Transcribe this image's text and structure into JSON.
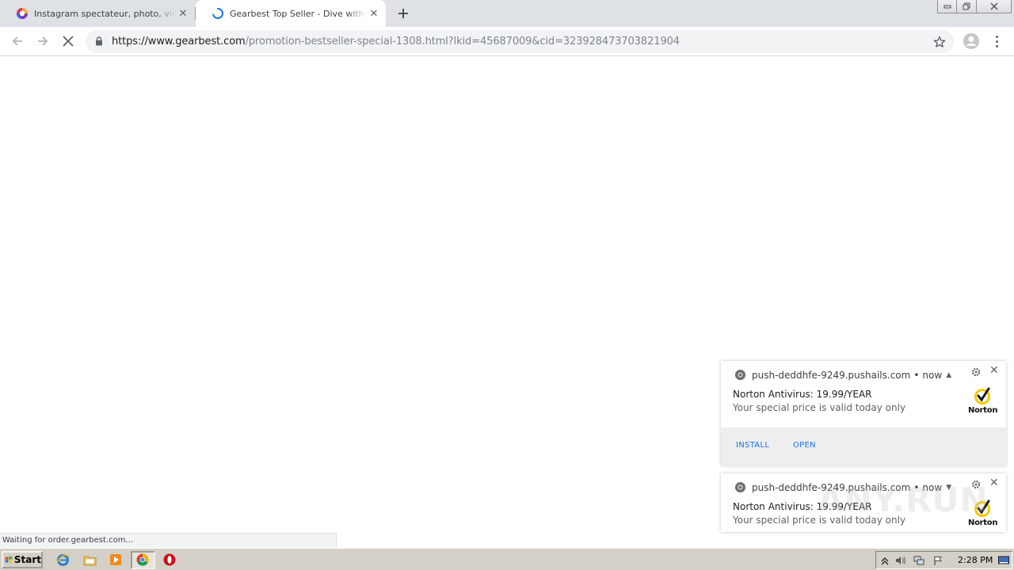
{
  "tabs": [
    {
      "title": "Instagram spectateur, photo, vidéo",
      "active": false
    },
    {
      "title": "Gearbest Top Seller - Dive with the Gearbest",
      "active": true,
      "loading": true
    }
  ],
  "address": {
    "host": "https://www.gearbest.com",
    "path": "/promotion-bestseller-special-1308.html?lkid=45687009&cid=323928473703821904"
  },
  "status_bubble": "Waiting for order.gearbest.com...",
  "notifications": [
    {
      "origin": "push-deddhfe-9249.pushails.com",
      "time": "now",
      "expanded": true,
      "title": "Norton Antivirus: 19.99/YEAR",
      "body": "Your special price is valid today only",
      "logo_text": "Norton",
      "actions": [
        "INSTALL",
        "OPEN"
      ]
    },
    {
      "origin": "push-deddhfe-9249.pushails.com",
      "time": "now",
      "expanded": false,
      "title": "Norton Antivirus: 19.99/YEAR",
      "body": "Your special price is valid today only",
      "logo_text": "Norton"
    }
  ],
  "watermark": "ANY.RUN",
  "taskbar": {
    "start_label": "Start",
    "clock": "2:28 PM",
    "pinned": [
      "ie-icon",
      "explorer-icon",
      "media-player-icon",
      "chrome-icon",
      "opera-icon"
    ]
  },
  "colors": {
    "tabstrip": "#dee1e6",
    "accent": "#1a73e8",
    "taskbar": "#d4d0c8",
    "norton_yellow": "#f7c800"
  }
}
